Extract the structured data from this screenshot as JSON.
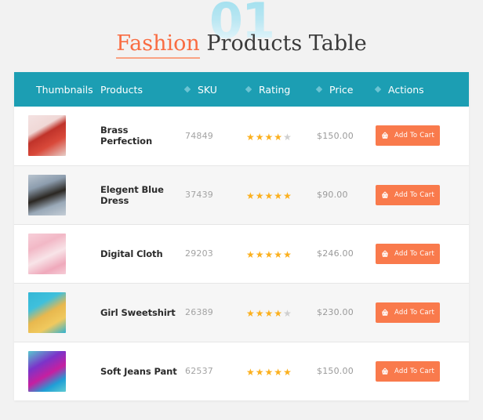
{
  "header": {
    "watermark": "01",
    "title_accent": "Fashion",
    "title_rest": " Products Table"
  },
  "table": {
    "columns": [
      {
        "label": "Thumbnails",
        "sortable": false
      },
      {
        "label": "Products",
        "sortable": false
      },
      {
        "label": "SKU",
        "sortable": true
      },
      {
        "label": "Rating",
        "sortable": true
      },
      {
        "label": "Price",
        "sortable": true
      },
      {
        "label": "Actions",
        "sortable": true
      }
    ],
    "action_label": "Add To Cart",
    "rows": [
      {
        "name": "Brass Perfection",
        "sku": "74849",
        "rating": 4,
        "rating_max": 5,
        "price": "$150.00",
        "thumb_alt": "woman-in-red-coat-and-hat"
      },
      {
        "name": "Elegent Blue Dress",
        "sku": "37439",
        "rating": 5,
        "rating_max": 5,
        "price": "$90.00",
        "thumb_alt": "woman-in-denim-jacket-and-black-hat"
      },
      {
        "name": "Digital Cloth",
        "sku": "29203",
        "rating": 5,
        "rating_max": 5,
        "price": "$246.00",
        "thumb_alt": "woman-with-pink-hair-on-pink-background"
      },
      {
        "name": "Girl Sweetshirt",
        "sku": "26389",
        "rating": 4,
        "rating_max": 5,
        "price": "$230.00",
        "thumb_alt": "woman-in-yellow-top-with-straw-hat"
      },
      {
        "name": "Soft Jeans Pant",
        "sku": "62537",
        "rating": 5,
        "rating_max": 5,
        "price": "$150.00",
        "thumb_alt": "person-in-purple-beanie-and-colorful-jacket"
      }
    ]
  },
  "colors": {
    "header_teal": "#1c9eb3",
    "accent_orange": "#f97a4c",
    "title_accent": "#f96c42",
    "star_filled": "#fbb01e",
    "star_empty": "#cfcfcf",
    "page_background": "#f2f2f2",
    "card_background": "#ffffff",
    "row_alt_background": "#f6f6f6",
    "watermark_blue": "#b8e6f2"
  },
  "icons": {
    "sort": "diamond-sort-icon",
    "cart": "shopping-basket-icon",
    "star": "star-icon"
  }
}
